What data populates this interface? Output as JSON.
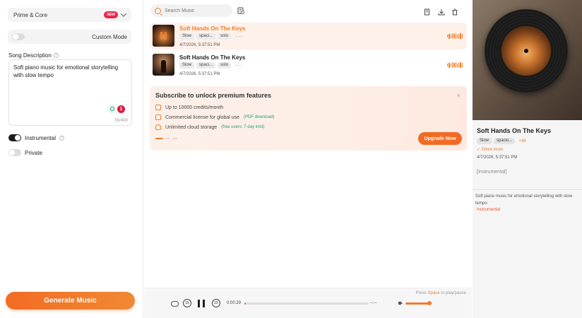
{
  "left": {
    "model": {
      "label": "Prime & Core",
      "badge": "NEW"
    },
    "custom_mode": {
      "label": "Custom Mode",
      "enabled": false
    },
    "song_description": {
      "title": "Song Description",
      "help": "?",
      "text": "Soft piano music for emotional storytelling with slow tempo",
      "error_count": "1",
      "counter": "59/400"
    },
    "instrumental": {
      "label": "Instrumental",
      "help": "?",
      "enabled": true
    },
    "private": {
      "label": "Private",
      "enabled": false
    },
    "generate_label": "Generate Music"
  },
  "middle": {
    "search": {
      "placeholder": "Search Music"
    },
    "tracks": [
      {
        "title": "Soft Hands On The Keys",
        "tags": [
          "Slow",
          "spaci...",
          "solo"
        ],
        "more": "···",
        "date": "4/7/2026, 5:37:51 PM",
        "active": true
      },
      {
        "title": "Soft Hands On The Keys",
        "tags": [
          "Slow",
          "spaci...",
          "solo"
        ],
        "more": "···",
        "date": "4/7/2026, 5:37:51 PM",
        "active": false
      }
    ],
    "promo": {
      "title": "Subscribe to unlock premium features",
      "close": "×",
      "features": [
        {
          "text": "Up to 10000 credits/month",
          "note": ""
        },
        {
          "text": "Commercial license for global use",
          "note": "(PDF download)"
        },
        {
          "text": "Unlimited cloud storage",
          "note": "(free users: 7-day limit)"
        }
      ],
      "upgrade_label": "Upgrade Now"
    }
  },
  "player": {
    "hint_prefix": "Press",
    "hint_key": "Space",
    "hint_suffix": "to play/pause",
    "rewind_label": "15",
    "forward_label": "15",
    "current_time": "0:00:29",
    "total_time": "--:--",
    "progress": 0.01,
    "volume": 0.9
  },
  "right": {
    "title": "Soft Hands On The Keys",
    "tags": [
      "Slow",
      "spacio..."
    ],
    "extra_tags": "+48",
    "show_more": "Show more",
    "date": "4/7/2026, 5:37:51 PM",
    "instrumental": "[Instrumental]",
    "description": "Soft piano music for emotional storytelling with slow tempo",
    "tagline": "Instrumental"
  },
  "colors": {
    "accent": "#f07d2e",
    "new_badge": "#e8274b",
    "success": "#1aa671"
  }
}
